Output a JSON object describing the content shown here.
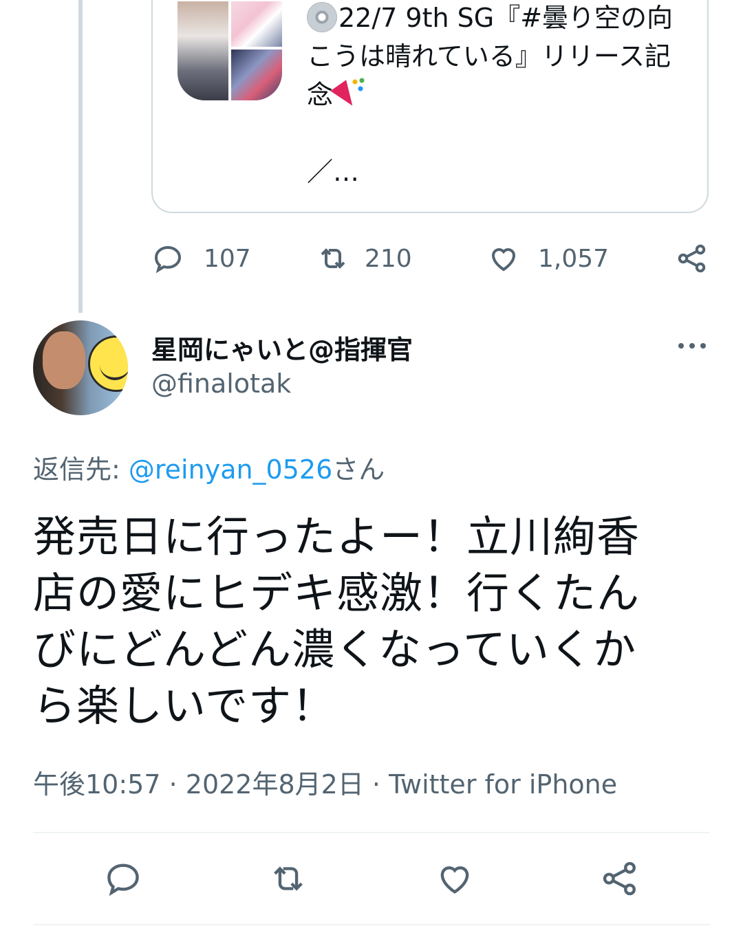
{
  "quoted_tweet": {
    "text_line1": "22/7 9th SG『#曇り空の向こうは晴れている』リリース記念",
    "text_line2": "／…",
    "disc_icon": "optical-disc-icon",
    "party_icon": "party-popper-icon",
    "reply_count": "107",
    "retweet_count": "210",
    "like_count": "1,057"
  },
  "tweet": {
    "display_name": "星岡にゃいと@指揮官",
    "handle": "@finalotak",
    "reply_to_prefix": "返信先: ",
    "reply_to_mention": "@reinyan_0526",
    "reply_to_suffix": "さん",
    "text": "発売日に行ったよー！立川絢香店の愛にヒデキ感激！行くたんびにどんどん濃くなっていくから楽しいです！",
    "time": "午後10:57",
    "sep1": " · ",
    "date": "2022年8月2日",
    "sep2": " · ",
    "source": "Twitter for iPhone"
  },
  "colors": {
    "link": "#1d9bf0",
    "secondary_text": "#536471",
    "border": "#cfd9de"
  }
}
